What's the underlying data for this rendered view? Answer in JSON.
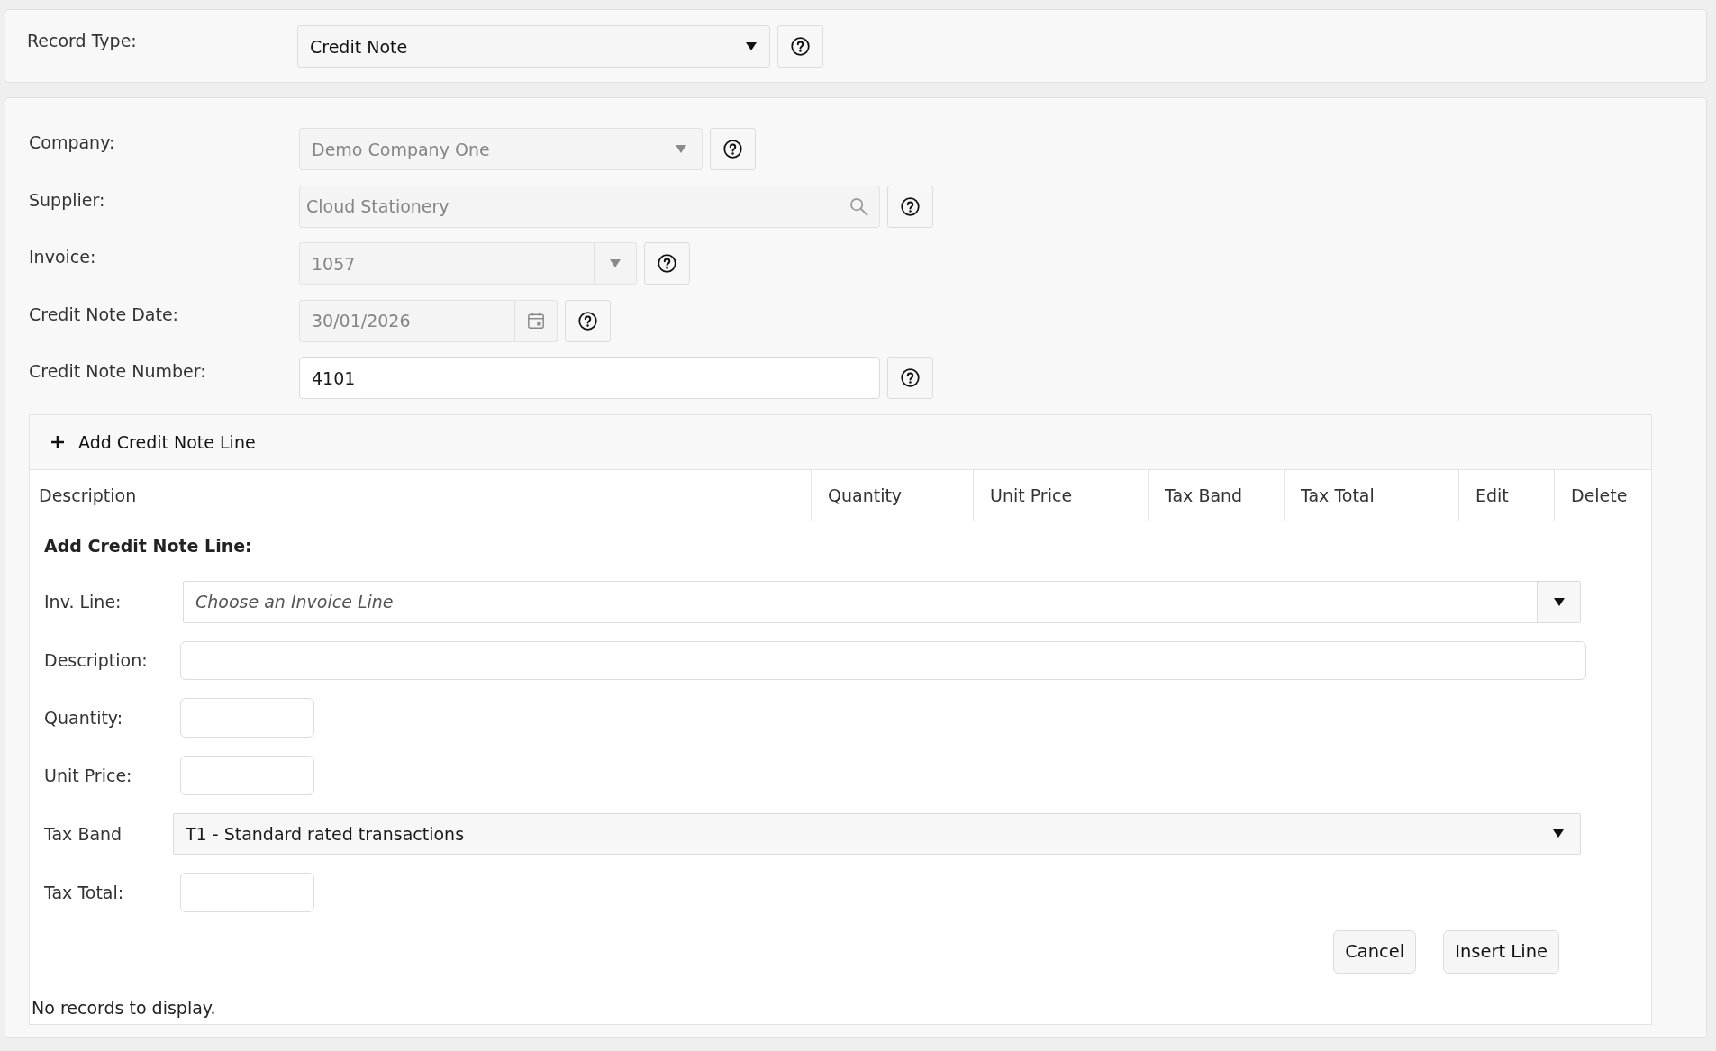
{
  "record_type": {
    "label": "Record Type:",
    "value": "Credit Note"
  },
  "header_form": {
    "fields": [
      {
        "kind": "select",
        "label": "Company:",
        "value": "Demo Company One",
        "disabled": true
      },
      {
        "kind": "search",
        "label": "Supplier:",
        "value": "Cloud Stationery",
        "disabled": true
      },
      {
        "kind": "combo",
        "label": "Invoice:",
        "value": "1057",
        "disabled": true
      },
      {
        "kind": "date",
        "label": "Credit Note Date:",
        "value": "30/01/2026",
        "disabled": true
      },
      {
        "kind": "text",
        "label": "Credit Note Number:",
        "value": "4101",
        "disabled": false
      }
    ]
  },
  "lines_grid": {
    "toolbar": {
      "add_button": "Add Credit Note Line"
    },
    "columns": [
      "Description",
      "Quantity",
      "Unit Price",
      "Tax Band",
      "Tax Total",
      "Edit",
      "Delete"
    ],
    "editor": {
      "title": "Add Credit Note Line:",
      "fields": [
        {
          "kind": "combo",
          "label": "Inv. Line:",
          "placeholder": "Choose an Invoice Line"
        },
        {
          "kind": "text",
          "label": "Description:"
        },
        {
          "kind": "number",
          "label": "Quantity:"
        },
        {
          "kind": "number",
          "label": "Unit Price:"
        },
        {
          "kind": "select",
          "label": "Tax Band",
          "value": "T1 - Standard rated transactions"
        },
        {
          "kind": "number",
          "label": "Tax Total:"
        }
      ],
      "buttons": [
        "Cancel",
        "Insert Line"
      ]
    },
    "empty_message": "No records to display."
  }
}
